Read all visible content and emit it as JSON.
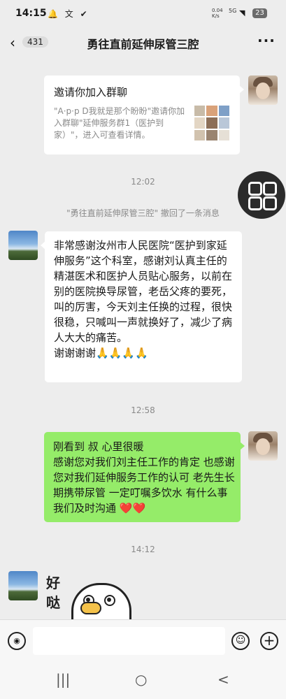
{
  "status_bar": {
    "time": "14:15",
    "notification_icons": "🔔 文 ✔",
    "network_speed_value": "0.04",
    "network_speed_unit": "K/s",
    "signal": "5G",
    "battery": "23"
  },
  "header": {
    "unread_count": "431",
    "title": "勇往直前延伸尿管三腔",
    "more": "···"
  },
  "messages": {
    "invite": {
      "title": "邀请你加入群聊",
      "description": "\"A·p·p   D我就是那个盼盼\"邀请你加入群聊\"延伸服务群1（医护到家）\"，进入可查看详情。"
    },
    "time1": "12:02",
    "recall_notice": "\"勇往直前延伸尿管三腔\" 撤回了一条消息",
    "patient_msg": "非常感谢汝州市人民医院“医护到家延伸服务”这个科室，感谢刘认真主任的精湛医术和医护人员贴心服务，以前在别的医院换导尿管，老岳父疼的要死，叫的厉害，今天刘主任换的过程，很快很稳，只喊叫一声就换好了，减少了病人大大的痛苦。\n谢谢谢谢🙏🙏🙏🙏",
    "time2": "12:58",
    "reply_msg": "刚看到 叔 心里很暖\n感谢您对我们刘主任工作的肯定 也感谢您对我们延伸服务工作的认可 老先生长期携带尿管 一定叮嘱多饮水 有什么事我们及时沟通 ❤️❤️",
    "time3": "14:12",
    "sticker_text_1": "好",
    "sticker_text_2": "哒"
  },
  "input": {
    "voice_icon": "voice-icon",
    "placeholder": "",
    "emoji_icon": "emoji-icon",
    "plus_icon": "plus-icon"
  },
  "nav": {
    "recents": "|||",
    "home": "○",
    "back": "<"
  }
}
